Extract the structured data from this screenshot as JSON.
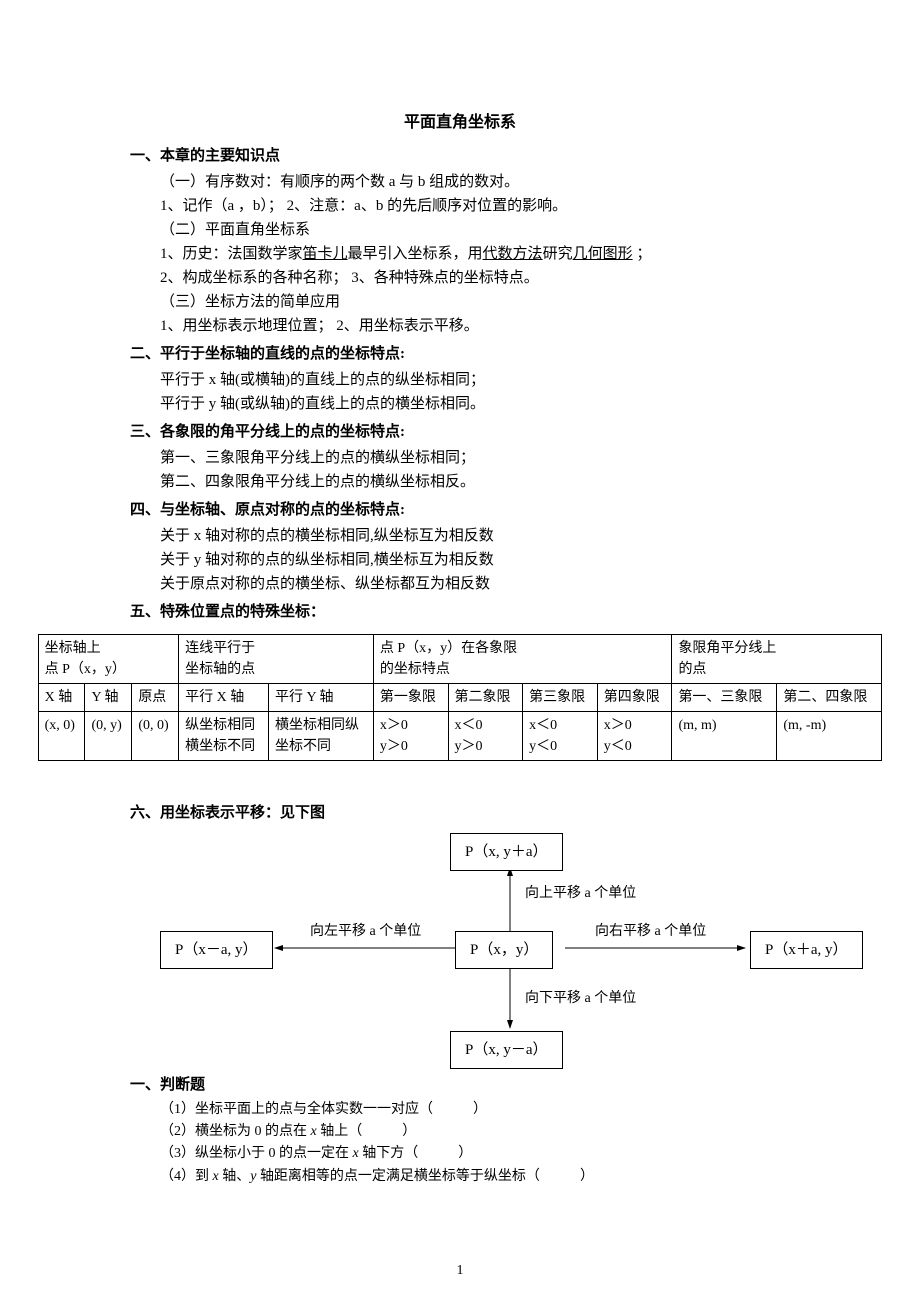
{
  "title": "平面直角坐标系",
  "s1": {
    "heading": "一、本章的主要知识点",
    "p1": "（一）有序数对：有顺序的两个数 a 与 b 组成的数对。",
    "p2": "1、记作（a ，b）； 2、注意：a、b 的先后顺序对位置的影响。",
    "p3": "（二）平面直角坐标系",
    "p4_pre": "1、历史：法国数学家",
    "p4_u1": "笛卡儿",
    "p4_mid": "最早引入坐标系，用",
    "p4_u2": "代数方法",
    "p4_mid2": "研究",
    "p4_u3": "几何图形",
    "p4_end": " ；",
    "p5": "2、构成坐标系的各种名称； 3、各种特殊点的坐标特点。",
    "p6": "（三）坐标方法的简单应用",
    "p7": "1、用坐标表示地理位置；    2、用坐标表示平移。"
  },
  "s2": {
    "heading": "二、平行于坐标轴的直线的点的坐标特点:",
    "p1": "平行于 x 轴(或横轴)的直线上的点的纵坐标相同；",
    "p2": "平行于 y 轴(或纵轴)的直线上的点的横坐标相同。"
  },
  "s3": {
    "heading": "三、各象限的角平分线上的点的坐标特点:",
    "p1": "第一、三象限角平分线上的点的横纵坐标相同；",
    "p2": "第二、四象限角平分线上的点的横纵坐标相反。"
  },
  "s4": {
    "heading": "四、与坐标轴、原点对称的点的坐标特点:",
    "p1": "关于 x 轴对称的点的横坐标相同,纵坐标互为相反数",
    "p2": "关于 y 轴对称的点的纵坐标相同,横坐标互为相反数",
    "p3": "关于原点对称的点的横坐标、纵坐标都互为相反数"
  },
  "s5": {
    "heading": "五、特殊位置点的特殊坐标："
  },
  "table": {
    "r1c1": "坐标轴上",
    "r1c1b": "点 P（x，y）",
    "r1c2": "连线平行于",
    "r1c2b": "坐标轴的点",
    "r1c3": "点 P（x，y）在各象限",
    "r1c3b": "的坐标特点",
    "r1c4": "象限角平分线上",
    "r1c4b": "的点",
    "r2c1": "X 轴",
    "r2c2": "Y 轴",
    "r2c3": "原点",
    "r2c4": "平行 X 轴",
    "r2c5": "平行 Y 轴",
    "r2c6": "第一象限",
    "r2c7": "第二象限",
    "r2c8": "第三象限",
    "r2c9": "第四象限",
    "r2c10": "第一、三象限",
    "r2c11": "第二、四象限",
    "r3c1": "(x, 0)",
    "r3c2": "(0, y)",
    "r3c3": "(0, 0)",
    "r3c4a": "纵坐标相同",
    "r3c4b": "横坐标不同",
    "r3c5a": "横坐标相同纵",
    "r3c5b": "坐标不同",
    "r3c6a": "x＞0",
    "r3c6b": "y＞0",
    "r3c7a": "x＜0",
    "r3c7b": "y＞0",
    "r3c8a": "x＜0",
    "r3c8b": "y＜0",
    "r3c9a": "x＞0",
    "r3c9b": "y＜0",
    "r3c10": "(m, m)",
    "r3c11": "(m, -m)"
  },
  "s6": {
    "heading": "六、用坐标表示平移：见下图",
    "top": "P（x, y＋a）",
    "left": "P（x－a, y）",
    "center": "P（x，y）",
    "right": "P（x＋a, y）",
    "bottom": "P（x, y－a）",
    "lbl_up": "向上平移 a 个单位",
    "lbl_left": "向左平移 a 个单位",
    "lbl_right": "向右平移 a 个单位",
    "lbl_down": "向下平移 a 个单位"
  },
  "judge": {
    "heading": "一、判断题",
    "q1a": "（1）坐标平面上的点与全体实数一一对应（",
    "q2a": "（2）横坐标为 0 的点在 ",
    "q2b": " 轴上（",
    "q3a": "（3）纵坐标小于 0 的点一定在 ",
    "q3b": " 轴下方（",
    "q4a": "（4）到 ",
    "q4b": " 轴、",
    "q4c": " 轴距离相等的点一定满足横坐标等于纵坐标（",
    "close": "）",
    "x": "x",
    "y": "y"
  },
  "pagenum": "1"
}
